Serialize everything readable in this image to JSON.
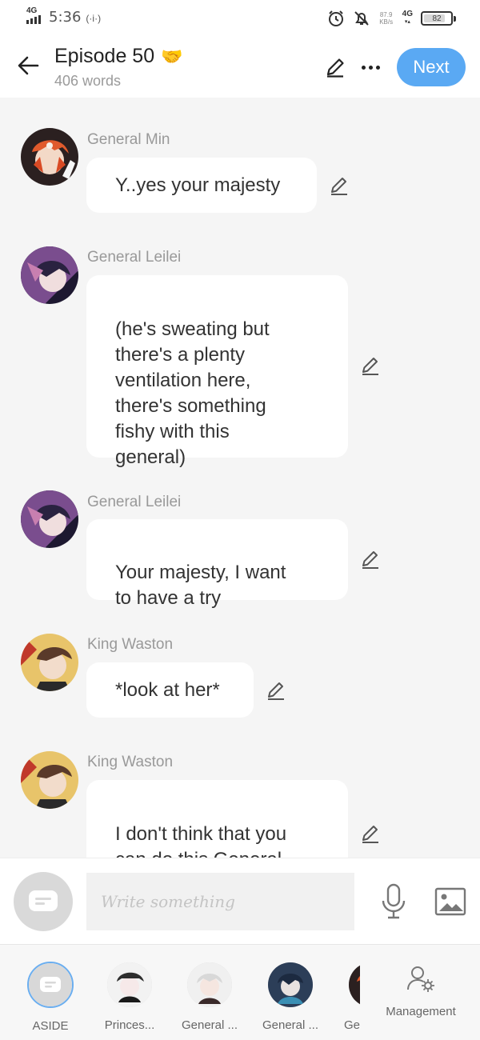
{
  "status_bar": {
    "network": "4G",
    "time": "5:36",
    "hotspot": "(·i·)",
    "speed_value": "87.9",
    "speed_unit": "KB/s",
    "network_right": "4G",
    "battery_level": "82"
  },
  "header": {
    "title": "Episode 50",
    "title_emoji": "🤝",
    "word_count": "406 words",
    "next_label": "Next"
  },
  "messages": [
    {
      "speaker": "General Min",
      "text": "Y..yes your majesty"
    },
    {
      "speaker": "General Leilei",
      "text": "(he's sweating but\nthere's a plenty\nventilation here,\nthere's something\nfishy with this\ngeneral)"
    },
    {
      "speaker": "General Leilei",
      "text": "Your majesty, I want\nto have a try"
    },
    {
      "speaker": "King Waston",
      "text": "*look at her*"
    },
    {
      "speaker": "King Waston",
      "text": "I don't think that you\ncan do this General\nLeilei"
    }
  ],
  "composer": {
    "placeholder": "Write something"
  },
  "characters": [
    {
      "label": "ASIDE"
    },
    {
      "label": "Princes..."
    },
    {
      "label": "General ..."
    },
    {
      "label": "General ..."
    },
    {
      "label": "Ger"
    }
  ],
  "management_label": "Management",
  "colors": {
    "accent": "#5aa9f3",
    "background": "#f5f5f5",
    "bubble": "#ffffff",
    "speaker_text": "#999999"
  }
}
